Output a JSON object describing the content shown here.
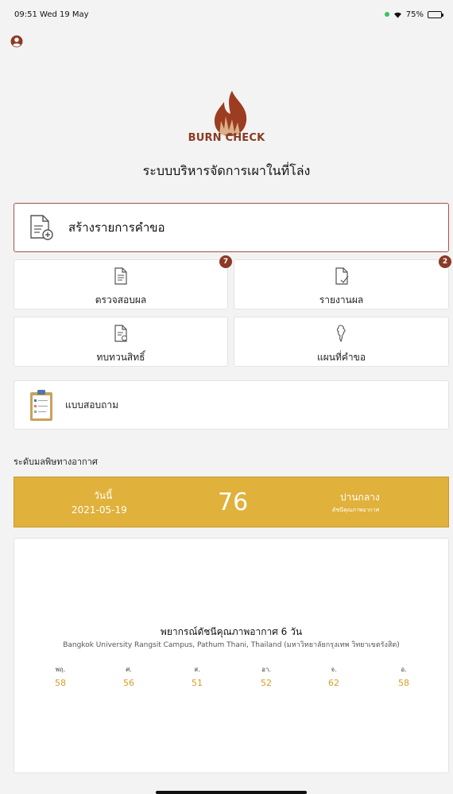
{
  "status_bar": {
    "time": "09:51",
    "date": "Wed 19 May",
    "battery": "75%",
    "battery_level": 0.75
  },
  "app": {
    "brand": "BURN CHECK",
    "subtitle": "ระบบบริหารจัดการเผาในที่โล่ง"
  },
  "menu": {
    "create_label": "สร้างรายการคำขอ",
    "tiles": [
      {
        "label": "ตรวจสอบผล",
        "badge": "7"
      },
      {
        "label": "รายงานผล",
        "badge": "2"
      },
      {
        "label": "ทบทวนสิทธิ์"
      },
      {
        "label": "แผนที่คำขอ"
      }
    ],
    "survey_label": "แบบสอบถาม"
  },
  "air_quality": {
    "section_title": "ระดับมลพิษทางอากาศ",
    "today_label": "วันนี้",
    "date": "2021-05-19",
    "aqi": "76",
    "level": "ปานกลาง",
    "caption": "ดัชนีคุณภาพอากาศ",
    "band_color": "#e0b13b"
  },
  "forecast": {
    "title": "พยากรณ์ดัชนีคุณภาพอากาศ 6 วัน",
    "location": "Bangkok University Rangsit Campus, Pathum Thani, Thailand (มหาวิทยาลัยกรุงเทพ วิทยาเขตรังสิต)",
    "days": [
      {
        "day": "พฤ.",
        "value": "58"
      },
      {
        "day": "ศ.",
        "value": "56"
      },
      {
        "day": "ส.",
        "value": "51"
      },
      {
        "day": "อา.",
        "value": "52"
      },
      {
        "day": "จ.",
        "value": "62"
      },
      {
        "day": "อ.",
        "value": "58"
      }
    ]
  },
  "colors": {
    "accent": "#8b3a25",
    "brand": "#8a3a22",
    "aqi_moderate": "#e0b13b",
    "forecast_value": "#d4a027"
  }
}
